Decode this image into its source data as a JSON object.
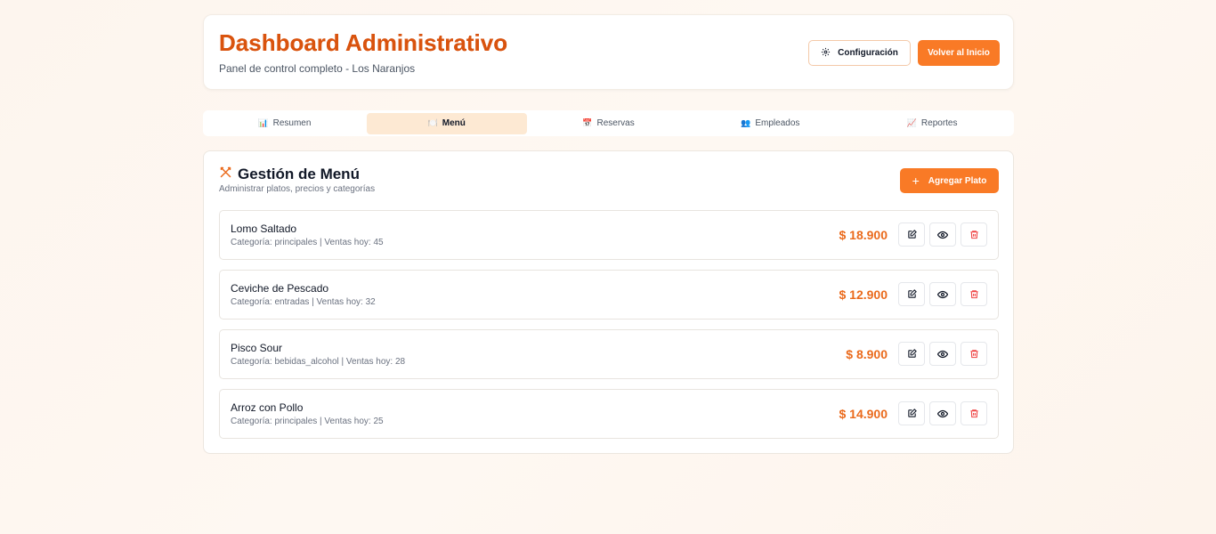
{
  "header": {
    "title": "Dashboard Administrativo",
    "subtitle": "Panel de control completo - Los Naranjos",
    "config_label": "Configuración",
    "home_label": "Volver al Inicio"
  },
  "tabs": [
    {
      "icon": "📊",
      "label": "Resumen",
      "active": false
    },
    {
      "icon": "🍽️",
      "label": "Menú",
      "active": true
    },
    {
      "icon": "📅",
      "label": "Reservas",
      "active": false
    },
    {
      "icon": "👥",
      "label": "Empleados",
      "active": false
    },
    {
      "icon": "📈",
      "label": "Reportes",
      "active": false
    }
  ],
  "menu": {
    "title": "Gestión de Menú",
    "subtitle": "Administrar platos, precios y categorías",
    "add_label": "Agregar Plato",
    "items": [
      {
        "name": "Lomo Saltado",
        "meta": "Categoría: principales | Ventas hoy: 45",
        "price": "$ 18.900"
      },
      {
        "name": "Ceviche de Pescado",
        "meta": "Categoría: entradas | Ventas hoy: 32",
        "price": "$ 12.900"
      },
      {
        "name": "Pisco Sour",
        "meta": "Categoría: bebidas_alcohol | Ventas hoy: 28",
        "price": "$ 8.900"
      },
      {
        "name": "Arroz con Pollo",
        "meta": "Categoría: principales | Ventas hoy: 25",
        "price": "$ 14.900"
      }
    ]
  },
  "colors": {
    "accent": "#f97a26",
    "title": "#d9530e",
    "price": "#ea6a1c",
    "delete": "#ef4444"
  }
}
